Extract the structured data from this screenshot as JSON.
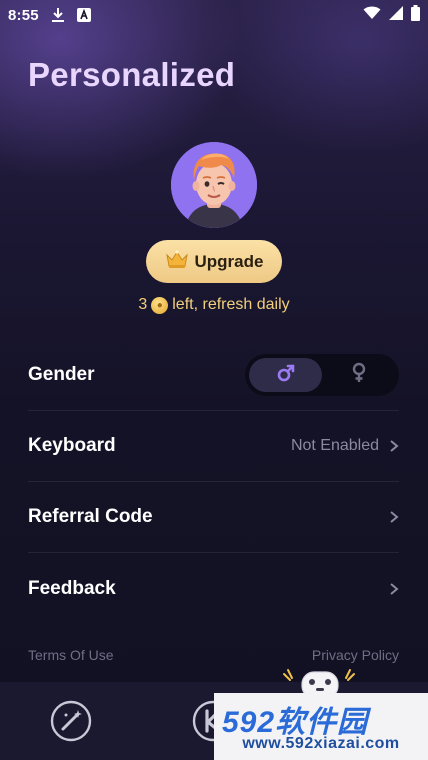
{
  "status_bar": {
    "time": "8:55",
    "left_icons": [
      "download-icon",
      "a-box-icon"
    ],
    "right_icons": [
      "wifi-icon",
      "signal-icon",
      "battery-icon"
    ]
  },
  "header": {
    "title": "Personalized"
  },
  "profile": {
    "avatar_icon": "avatar-cartoon-man",
    "avatar_bg": "#8e72f0",
    "upgrade_label": "Upgrade",
    "credits_count": "3",
    "credits_suffix": "left, refresh daily"
  },
  "settings": {
    "gender": {
      "label": "Gender",
      "options": [
        "male-icon",
        "female-icon"
      ],
      "selected": "male"
    },
    "keyboard": {
      "label": "Keyboard",
      "value": "Not Enabled"
    },
    "referral": {
      "label": "Referral Code"
    },
    "feedback": {
      "label": "Feedback"
    }
  },
  "footer": {
    "terms": "Terms Of Use",
    "privacy": "Privacy Policy"
  },
  "bottom_nav": {
    "items": [
      "magic-wand-icon",
      "keyboard-k-icon"
    ]
  },
  "watermark": {
    "main": "592软件园",
    "sub": "www.592xiazai.com"
  },
  "colors": {
    "accent": "#9b7bf2",
    "title": "#e9d6ff",
    "upgrade_bg": "#f3d191",
    "credits_text": "#f2cf7a",
    "watermark_blue": "#2b6bd8"
  }
}
